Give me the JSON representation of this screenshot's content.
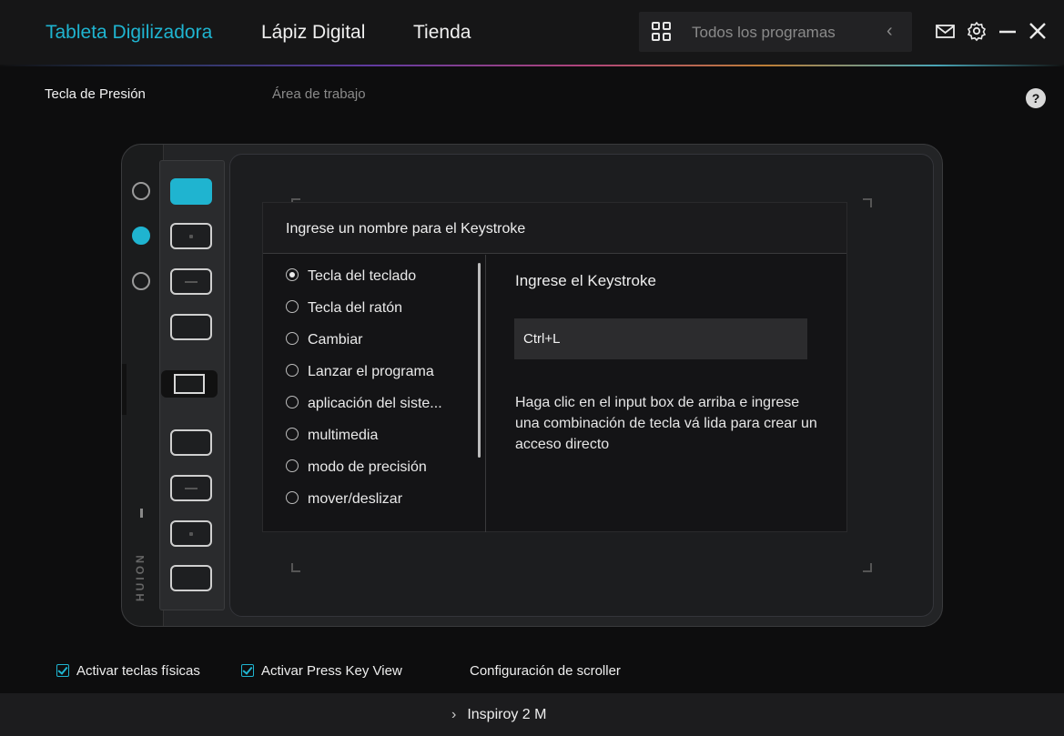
{
  "nav": {
    "tabs": [
      {
        "label": "Tableta Digilizadora",
        "active": true
      },
      {
        "label": "Lápiz Digital",
        "active": false
      },
      {
        "label": "Tienda",
        "active": false
      }
    ],
    "programs_label": "Todos los programas",
    "icons": [
      "grid-icon",
      "chevron-left-icon",
      "mail-icon",
      "gear-icon",
      "minimize-icon",
      "close-icon"
    ]
  },
  "subtabs": [
    {
      "label": "Tecla de Presión",
      "active": true
    },
    {
      "label": "Área de trabajo",
      "active": false
    }
  ],
  "help_label": "?",
  "device": {
    "brand": "HUION",
    "pen_buttons": 3,
    "active_pen_button": 2,
    "active_express_key": 1
  },
  "dialog": {
    "title": "Ingrese un nombre para el Keystroke",
    "options": [
      {
        "label": "Tecla del teclado",
        "selected": true
      },
      {
        "label": "Tecla del ratón",
        "selected": false
      },
      {
        "label": "Cambiar",
        "selected": false
      },
      {
        "label": "Lanzar el programa",
        "selected": false
      },
      {
        "label": "aplicación del siste...",
        "selected": false
      },
      {
        "label": "multimedia",
        "selected": false
      },
      {
        "label": "modo de precisión",
        "selected": false
      },
      {
        "label": "mover/deslizar",
        "selected": false
      }
    ],
    "right_title": "Ingrese el Keystroke",
    "keystroke_value": "Ctrl+L",
    "hint": "Haga clic en el input box de arriba e ingrese una combinación de tecla vá lida para crear un acceso directo"
  },
  "options": {
    "physical_keys": "Activar teclas físicas",
    "press_key_view": "Activar Press Key View",
    "scroller": "Configuración de scroller"
  },
  "footer": {
    "device_name": "Inspiroy 2 M"
  },
  "colors": {
    "accent": "#1fb4d0",
    "background": "#0d0d0e"
  }
}
